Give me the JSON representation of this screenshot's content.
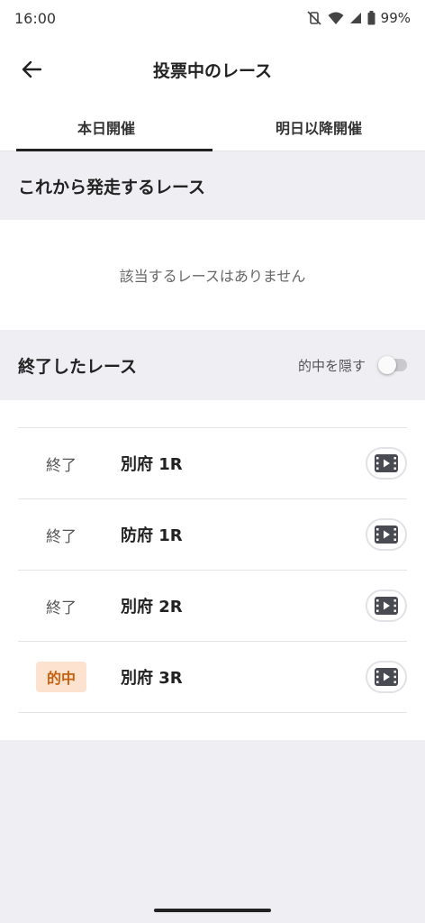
{
  "status_bar": {
    "time": "16:00",
    "battery": "99%"
  },
  "appbar": {
    "title": "投票中のレース"
  },
  "tabs": [
    {
      "label": "本日開催",
      "active": true
    },
    {
      "label": "明日以降開催",
      "active": false
    }
  ],
  "upcoming": {
    "title": "これから発走するレース",
    "empty_message": "該当するレースはありません"
  },
  "finished": {
    "title": "終了したレース",
    "hide_hits_label": "的中を隠す",
    "hide_hits_on": false,
    "races": [
      {
        "status": "終了",
        "hit": false,
        "name": "別府 1R"
      },
      {
        "status": "終了",
        "hit": false,
        "name": "防府 1R"
      },
      {
        "status": "終了",
        "hit": false,
        "name": "別府 2R"
      },
      {
        "status": "的中",
        "hit": true,
        "name": "別府 3R"
      }
    ]
  },
  "colors": {
    "hit_badge_bg": "#fde3cf",
    "hit_badge_text": "#c4600e",
    "page_bg": "#efeef3"
  }
}
